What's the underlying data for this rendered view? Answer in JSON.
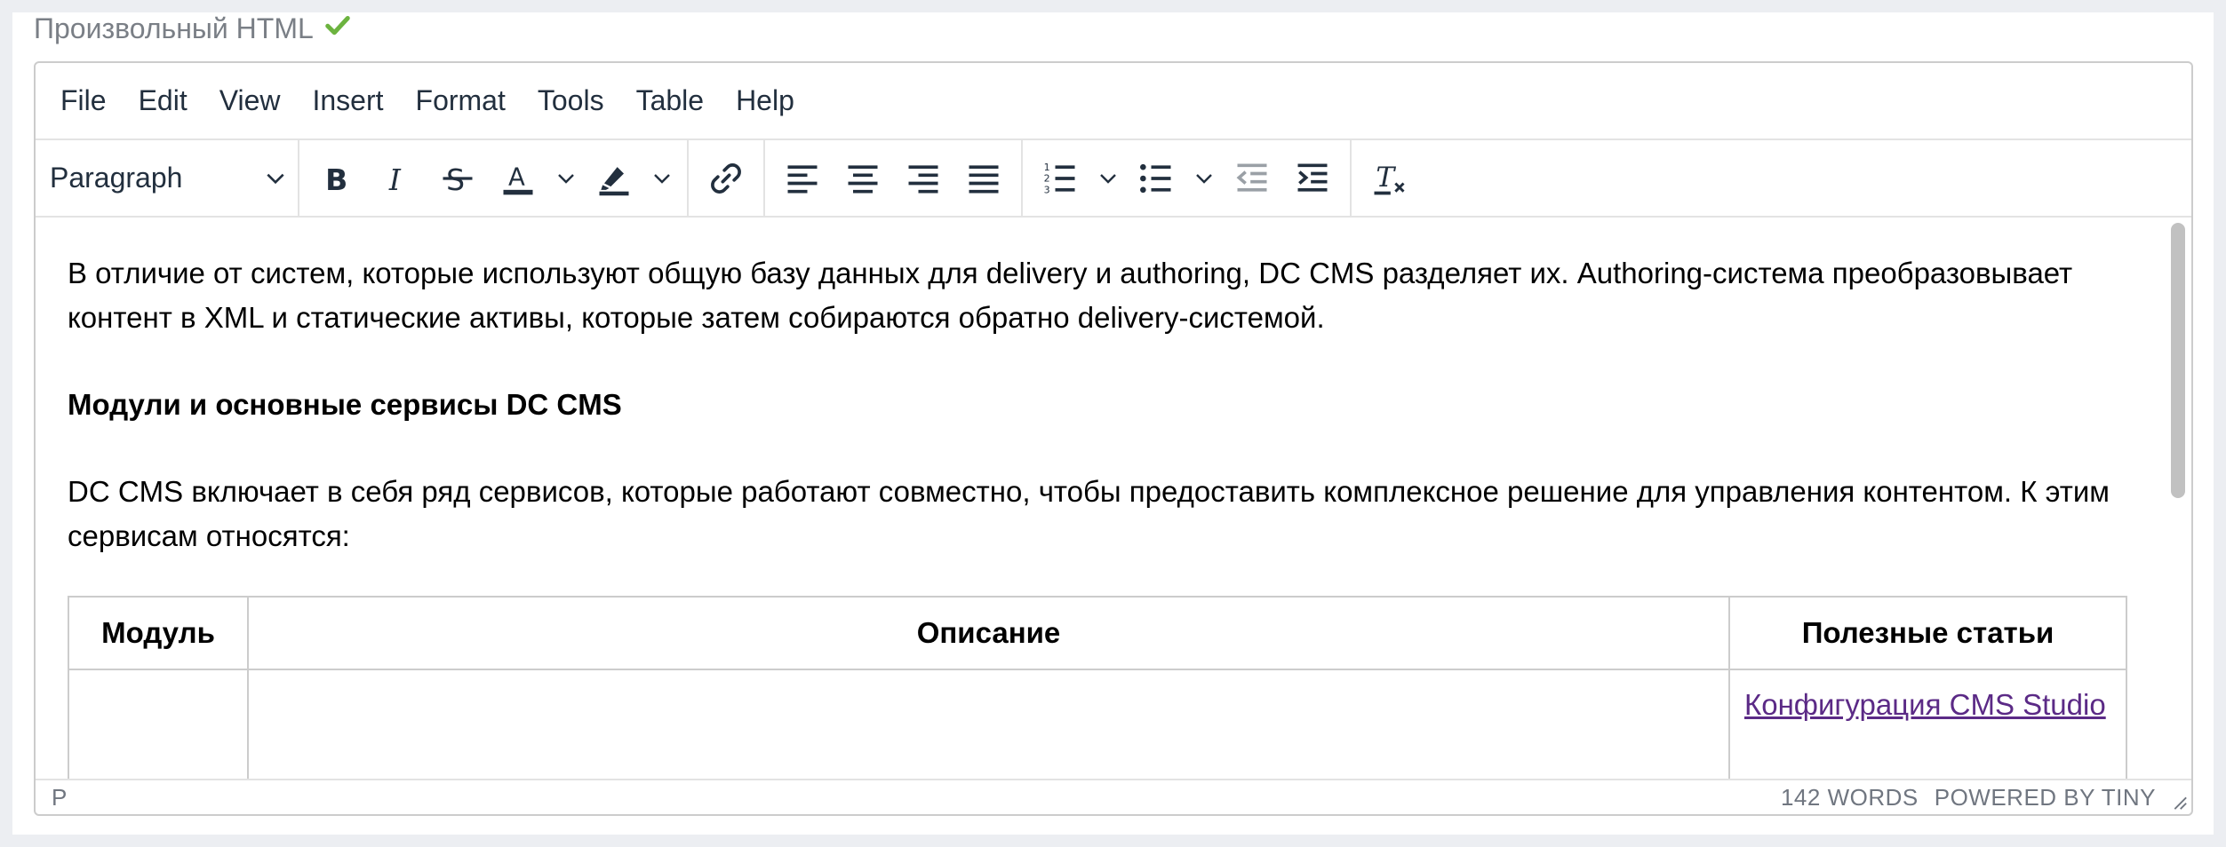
{
  "field": {
    "label": "Произвольный HTML",
    "check_icon": "check-icon",
    "check_color": "#6cb33f"
  },
  "menubar": {
    "items": [
      "File",
      "Edit",
      "View",
      "Insert",
      "Format",
      "Tools",
      "Table",
      "Help"
    ]
  },
  "toolbar": {
    "block_format": "Paragraph",
    "icons": {
      "bold": "bold-icon",
      "italic": "italic-icon",
      "strike": "strikethrough-icon",
      "text_color": "text-color-icon",
      "highlight": "highlight-icon",
      "link": "link-icon",
      "align_left": "align-left-icon",
      "align_center": "align-center-icon",
      "align_right": "align-right-icon",
      "justify": "align-justify-icon",
      "numbered_list": "numbered-list-icon",
      "bullet_list": "bullet-list-icon",
      "outdent": "outdent-icon",
      "indent": "indent-icon",
      "clear_format": "clear-formatting-icon"
    },
    "text_color_swatch": "#222f3e"
  },
  "content": {
    "p1": "В отличие от систем, которые используют общую базу данных для delivery и authoring, DC CMS разделяет их. Authoring-система преобразовывает контент в XML и статические активы, которые затем собираются обратно delivery-системой.",
    "heading": "Модули и основные сервисы DC CMS",
    "p2": "DC CMS включает в себя ряд сервисов, которые работают совместно, чтобы предоставить комплексное решение для управления контентом. К этим сервисам относятся:",
    "table": {
      "headers": [
        "Модуль",
        "Описание",
        "Полезные статьи"
      ],
      "row1": [
        "",
        "",
        "Конфигурация CMS Studio"
      ]
    },
    "link_color": "#5b2a86"
  },
  "statusbar": {
    "path": "P",
    "word_count": "142 WORDS",
    "powered": "POWERED BY TINY"
  }
}
